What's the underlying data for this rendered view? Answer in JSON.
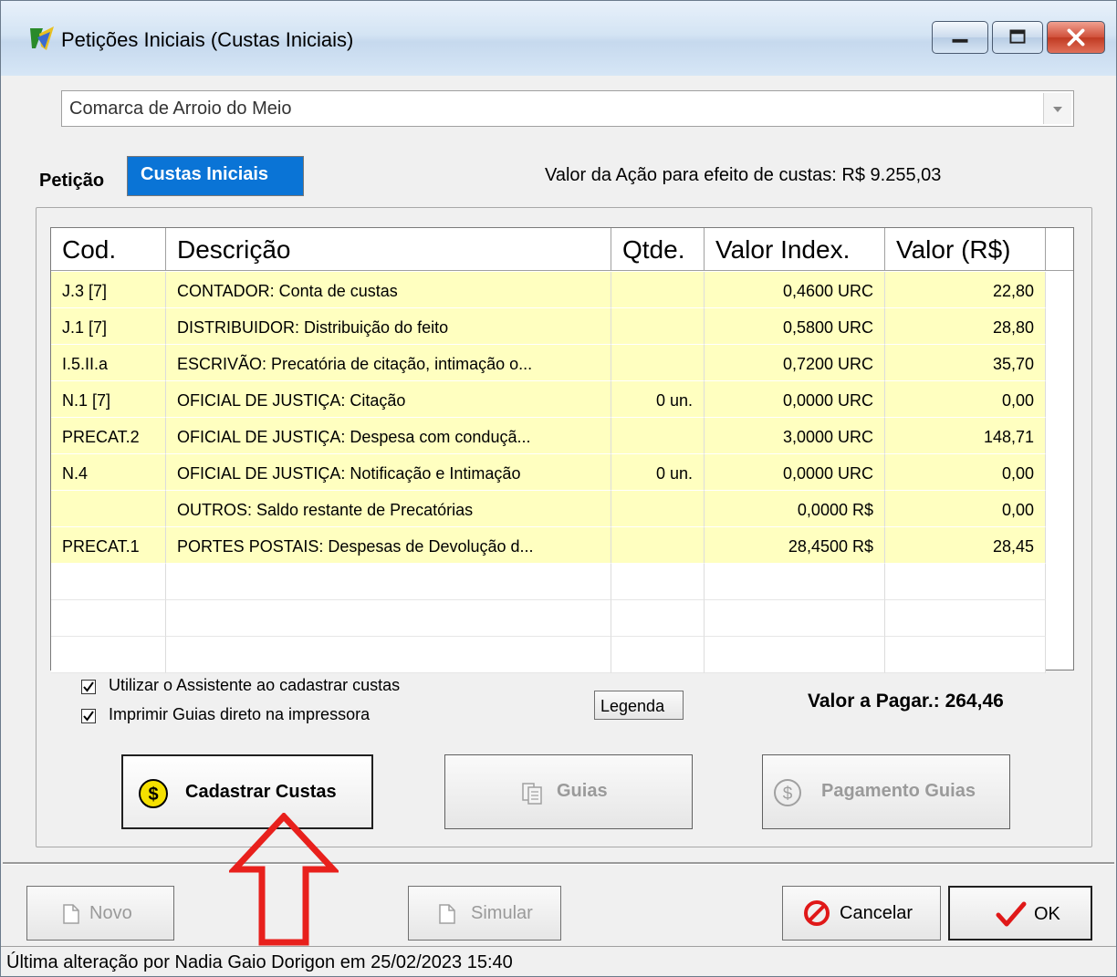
{
  "window": {
    "title": "Petições Iniciais (Custas Iniciais)"
  },
  "comarca": {
    "value": "Comarca de Arroio do Meio"
  },
  "tabs": [
    {
      "label": "Petição",
      "active": false
    },
    {
      "label": "Custas Iniciais",
      "active": true
    }
  ],
  "valor_acao": "Valor da Ação para efeito de custas: R$ 9.255,03",
  "table": {
    "headers": [
      "Cod.",
      "Descrição",
      "Qtde.",
      "Valor Index.",
      "Valor (R$)"
    ],
    "rows": [
      [
        "J.3 [7]",
        "CONTADOR: Conta de custas",
        "",
        "0,4600 URC",
        "22,80"
      ],
      [
        "J.1 [7]",
        "DISTRIBUIDOR: Distribuição do feito",
        "",
        "0,5800 URC",
        "28,80"
      ],
      [
        "I.5.II.a",
        "ESCRIVÃO: Precatória de citação, intimação o...",
        "",
        "0,7200 URC",
        "35,70"
      ],
      [
        "N.1 [7]",
        "OFICIAL DE JUSTIÇA: Citação",
        "0 un.",
        "0,0000 URC",
        "0,00"
      ],
      [
        "PRECAT.2",
        "OFICIAL DE JUSTIÇA: Despesa com conduçã...",
        "",
        "3,0000 URC",
        "148,71"
      ],
      [
        "N.4",
        "OFICIAL DE JUSTIÇA: Notificação e Intimação",
        "0 un.",
        "0,0000 URC",
        "0,00"
      ],
      [
        "",
        "OUTROS: Saldo restante de Precatórias",
        "",
        "0,0000 R$",
        "0,00"
      ],
      [
        "PRECAT.1",
        "PORTES POSTAIS: Despesas de Devolução d...",
        "",
        "28,4500 R$",
        "28,45"
      ]
    ]
  },
  "options": {
    "assistente": {
      "label": "Utilizar o Assistente ao cadastrar custas",
      "checked": true
    },
    "imprimir": {
      "label": "Imprimir Guias direto na impressora",
      "checked": true
    }
  },
  "buttons": {
    "legenda": "Legenda",
    "cadastrar": "Cadastrar Custas",
    "guias": "Guias",
    "pagamento": "Pagamento Guias",
    "novo": "Novo",
    "simular": "Simular",
    "cancelar": "Cancelar",
    "ok": "OK"
  },
  "valor_pagar": "Valor a Pagar.: 264,46",
  "status": "Última alteração por Nadia Gaio Dorigon em 25/02/2023 15:40",
  "colors": {
    "tab_active": "#0a74d6",
    "row_highlight": "#ffffc0",
    "arrow": "#e8201c"
  },
  "icons": [
    "app-icon",
    "minimize-icon",
    "maximize-icon",
    "close-icon",
    "dropdown-arrow-icon",
    "dollar-coin-icon",
    "documents-icon",
    "dollar-outline-icon",
    "new-document-icon",
    "cancel-icon",
    "checkmark-icon"
  ]
}
